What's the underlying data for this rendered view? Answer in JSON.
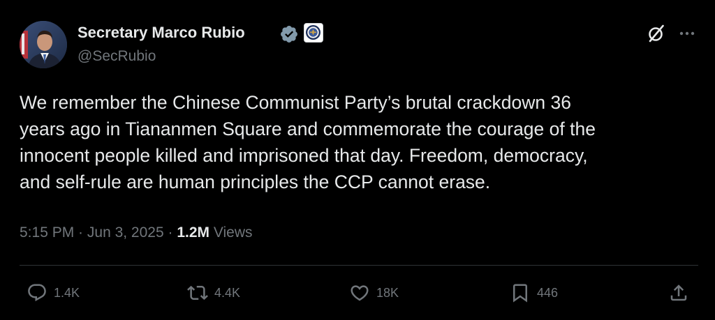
{
  "author": {
    "display_name": "Secretary Marco Rubio",
    "handle": "@SecRubio",
    "avatar_icon": "profile-photo",
    "verified_badge_icon": "verified-check-icon",
    "affiliate_badge_icon": "state-department-seal-icon"
  },
  "header_actions": {
    "grok_icon": "grok-icon",
    "more_icon": "more-options-icon"
  },
  "tweet": {
    "text": "We remember the Chinese Communist Party’s brutal crackdown 36\nyears ago in Tiananmen Square and commemorate the courage of the\ninnocent people killed and imprisoned that day. Freedom, democracy,\nand self-rule are human principles the CCP cannot erase.",
    "time": "5:15 PM",
    "separator_1": " · ",
    "date": "Jun 3, 2025",
    "separator_2": " · ",
    "views_count": "1.2M",
    "views_label": " Views"
  },
  "actions": {
    "replies": "1.4K",
    "reposts": "4.4K",
    "likes": "18K",
    "bookmarks": "446"
  },
  "colors": {
    "background": "#000000",
    "primary_text": "#e7e9ea",
    "secondary_text": "#71767b",
    "divider": "#2f3336",
    "verified": "#829aab"
  }
}
